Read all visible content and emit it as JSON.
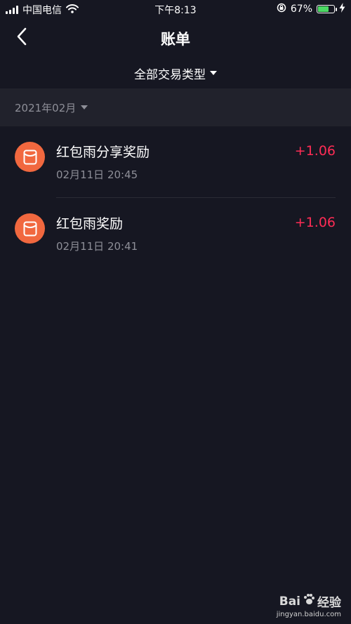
{
  "status_bar": {
    "carrier": "中国电信",
    "time": "下午8:13",
    "battery_percent": "67%",
    "battery_level": 0.67
  },
  "header": {
    "title": "账单"
  },
  "filter": {
    "label": "全部交易类型"
  },
  "month": {
    "label": "2021年02月"
  },
  "transactions": [
    {
      "title": "红包雨分享奖励",
      "time": "02月11日 20:45",
      "amount": "+1.06"
    },
    {
      "title": "红包雨奖励",
      "time": "02月11日 20:41",
      "amount": "+1.06"
    }
  ],
  "watermark": {
    "brand": "Bai",
    "brand_suffix": "经验",
    "url": "jingyan.baidu.com"
  },
  "colors": {
    "background": "#161722",
    "section": "#21222c",
    "accent_icon": "#f1683f",
    "amount": "#fe2c55"
  }
}
